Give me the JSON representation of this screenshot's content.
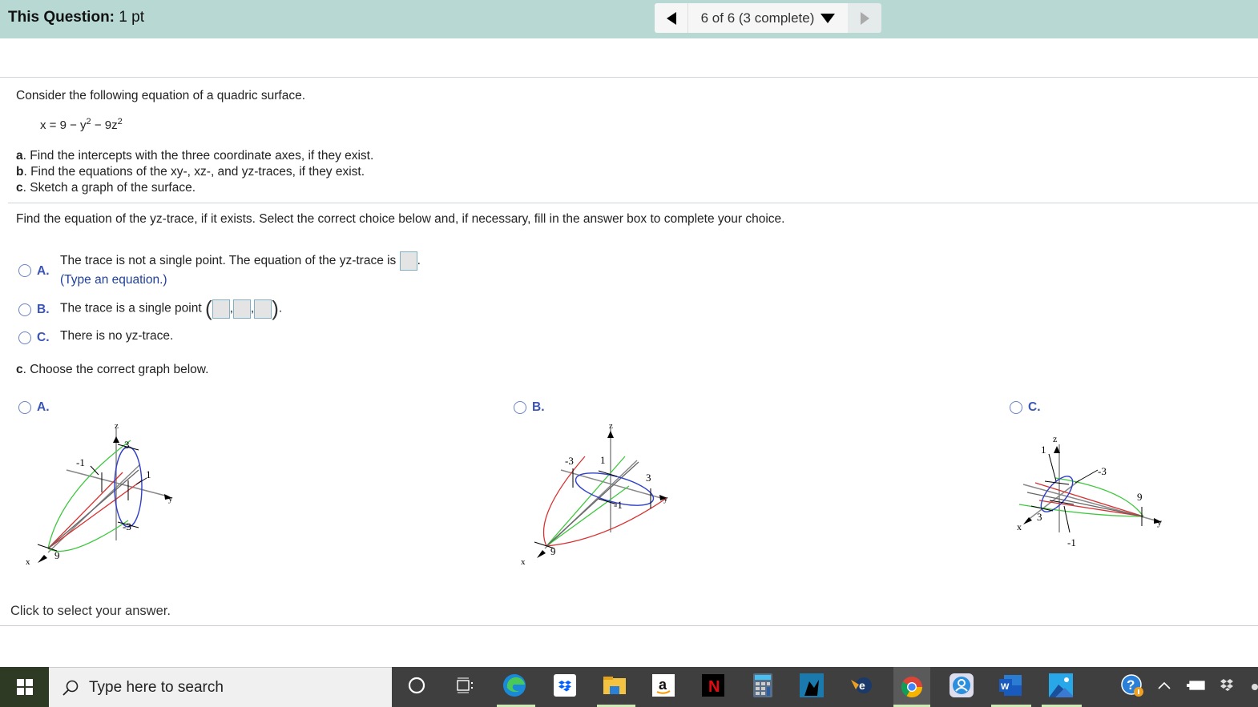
{
  "header": {
    "question_label": "This Question:",
    "points": "1 pt",
    "nav_status": "6 of 6 (3 complete)"
  },
  "problem": {
    "intro": "Consider the following equation of a quadric surface.",
    "equation": {
      "lhs": "x = 9 − y",
      "exp1": "2",
      "mid": " − 9z",
      "exp2": "2"
    },
    "parts": [
      {
        "letter": "a",
        "text": ". Find the intercepts with the three coordinate axes, if they exist."
      },
      {
        "letter": "b",
        "text": ". Find the equations of the xy-, xz-, and yz-traces, if they exist."
      },
      {
        "letter": "c",
        "text": ". Sketch a graph of the surface."
      }
    ]
  },
  "question": {
    "prompt": "Find the equation of the yz-trace, if it exists. Select the correct choice below and, if necessary, fill in the answer box to complete your choice.",
    "choices": [
      {
        "letter": "A.",
        "text": "The trace is not a single point. The equation of the yz-trace is",
        "hint": "(Type an equation.)",
        "answer_value": ""
      },
      {
        "letter": "B.",
        "text": "The trace is a single point",
        "point_values": [
          "",
          "",
          ""
        ]
      },
      {
        "letter": "C.",
        "text": "There is no yz-trace."
      }
    ]
  },
  "graph_question": {
    "letter": "c",
    "prompt": ". Choose the correct graph below.",
    "options": [
      {
        "letter": "A.",
        "labels": {
          "z": "z",
          "y": "y",
          "x": "x",
          "top": "3",
          "bottom": "-3",
          "left": "-1",
          "right": "1",
          "apex": "9"
        }
      },
      {
        "letter": "B.",
        "labels": {
          "z": "z",
          "y": "y",
          "x": "x",
          "left": "-3",
          "top": "1",
          "right": "3",
          "bottom": "-1",
          "apex": "9"
        }
      },
      {
        "letter": "C.",
        "labels": {
          "z": "z",
          "y": "y",
          "x": "x",
          "top": "1",
          "right": "-3",
          "left": "3",
          "bottom": "-1",
          "apex": "9"
        }
      }
    ]
  },
  "footer": {
    "status": "Click to select your answer."
  },
  "taskbar": {
    "search_placeholder": "Type here to search",
    "apps": [
      "cortana",
      "task-view",
      "edge",
      "dropbox",
      "file-explorer",
      "amazon",
      "netflix",
      "calculator",
      "kindle",
      "ie-tool",
      "chrome",
      "people",
      "word",
      "photos"
    ],
    "tray": [
      "help",
      "show-hidden",
      "battery",
      "dropbox"
    ]
  },
  "colors": {
    "header_bg": "#b8d8d4",
    "option_blue": "#3a55b5",
    "trace_green": "#3cc83c",
    "trace_red": "#d83030",
    "trace_blue": "#3040c8"
  }
}
